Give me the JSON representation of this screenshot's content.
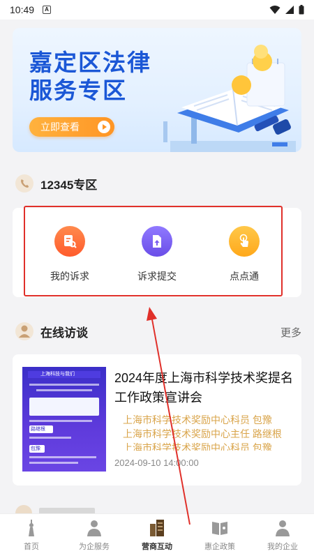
{
  "status_bar": {
    "time": "10:49",
    "notification_letter": "A"
  },
  "banner": {
    "title_line1": "嘉定区法律",
    "title_line2": "服务专区",
    "cta_label": "立即查看"
  },
  "section_12345": {
    "title": "12345专区",
    "items": [
      {
        "label": "我的诉求",
        "icon": "document-search-icon",
        "color": "#ff6a35"
      },
      {
        "label": "诉求提交",
        "icon": "upload-file-icon",
        "color": "#7a5cf0"
      },
      {
        "label": "点点通",
        "icon": "tap-hand-icon",
        "color": "#ffb21f"
      }
    ]
  },
  "section_interview": {
    "title": "在线访谈",
    "more_label": "更多",
    "article": {
      "title": "2024年度上海市科学技术奖提名工作政策宣讲会",
      "speakers": [
        "上海市科学技术奖励中心科员 包豫",
        "上海市科学技术奖励中心主任 路继根",
        "上海市科学技术奖励中心科员 包豫"
      ],
      "datetime": "2024-09-10 14:00:00",
      "thumb": {
        "brand": "上海科技与我们",
        "tag1": "路继根",
        "tag2": "包豫"
      }
    }
  },
  "bottom_nav": {
    "items": [
      {
        "label": "首页",
        "icon": "tower-icon"
      },
      {
        "label": "为企服务",
        "icon": "service-person-icon"
      },
      {
        "label": "营商互动",
        "icon": "interaction-icon"
      },
      {
        "label": "惠企政策",
        "icon": "policy-icon"
      },
      {
        "label": "我的企业",
        "icon": "user-icon"
      }
    ],
    "active_index": 2
  },
  "colors": {
    "accent_orange": "#ff9524",
    "brand_blue": "#1b57d6",
    "annotation_red": "#e0302a",
    "speaker_gold": "#d9a44a"
  }
}
